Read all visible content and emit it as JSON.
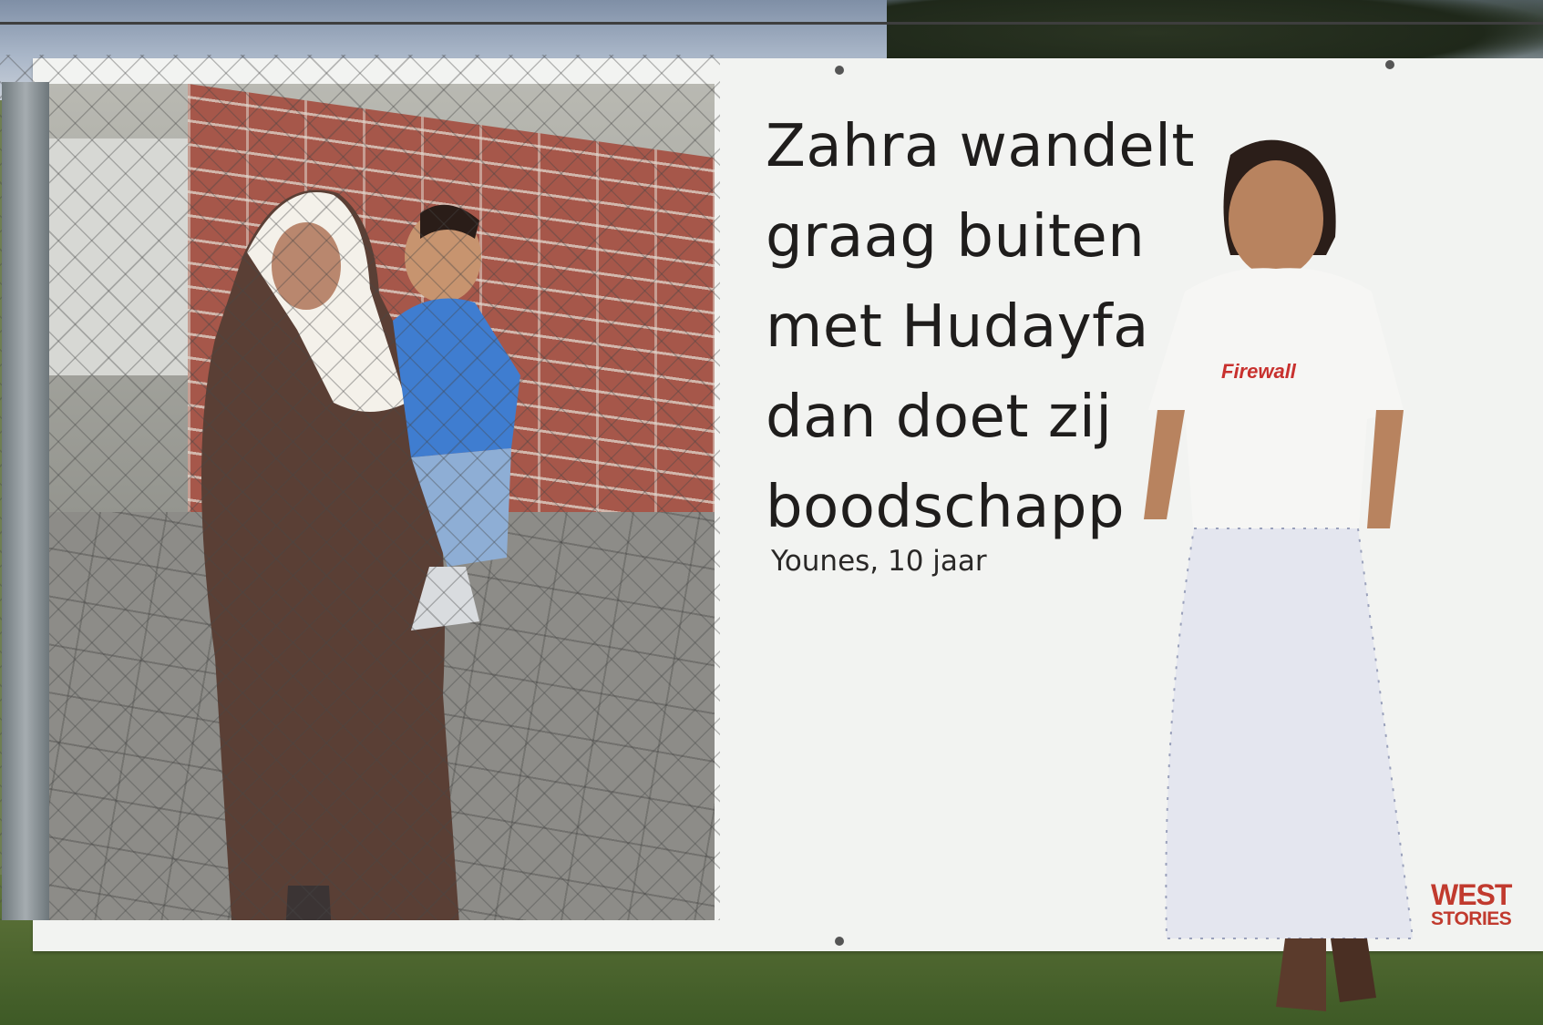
{
  "banner": {
    "quote_lines": [
      "Zahra wandelt",
      "graag buiten",
      "met Hudayfa",
      "dan doet zij",
      "boodschapp"
    ],
    "quote_visible": "Zahra wandelt\ngraag buiten\nmet Hudayfa\ndan doet zij\nboodschapp",
    "author": "Younes, 10 jaar",
    "logo": {
      "line1": "WEST",
      "line2": "STORIES"
    }
  },
  "shirt_text": "Firewall",
  "colors": {
    "banner_background": "#f2f3f1",
    "text": "#1f1d1c",
    "logo": "#c13a2e",
    "brick": "#a6574a",
    "grass": "#4f6730"
  }
}
